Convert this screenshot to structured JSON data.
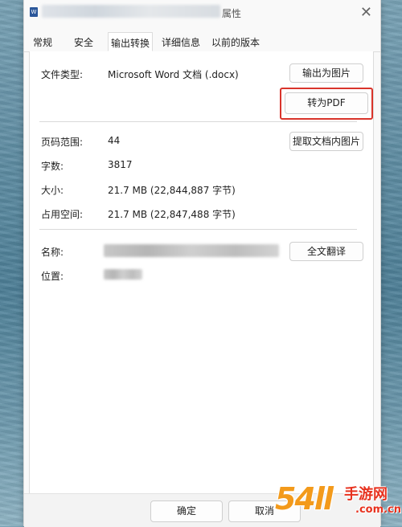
{
  "window": {
    "title": "属性",
    "close_glyph": "✕",
    "app_icon_glyph": "W"
  },
  "tabs": [
    {
      "label": "常规"
    },
    {
      "label": "安全"
    },
    {
      "label": "输出转换",
      "active": true
    },
    {
      "label": "详细信息"
    },
    {
      "label": "以前的版本"
    }
  ],
  "file_type": {
    "label": "文件类型:",
    "value": "Microsoft Word 文档 (.docx)",
    "export_image_button": "输出为图片",
    "to_pdf_button": "转为PDF"
  },
  "stats": {
    "page_range_label": "页码范围:",
    "page_range_value": "44",
    "word_count_label": "字数:",
    "word_count_value": "3817",
    "size_label": "大小:",
    "size_value": "21.7 MB (22,844,887 字节)",
    "disk_size_label": "占用空间:",
    "disk_size_value": "21.7 MB (22,847,488 字节)",
    "extract_images_button": "提取文档内图片"
  },
  "info": {
    "name_label": "名称:",
    "location_label": "位置:",
    "translate_button": "全文翻译"
  },
  "footer": {
    "ok_button": "确定",
    "cancel_button": "取消"
  },
  "watermark": {
    "brand_number": "54ll",
    "brand_cn": "手游网",
    "brand_url": ".com.cn"
  },
  "colors": {
    "highlight": "#d9342b",
    "word_icon": "#2b579a"
  }
}
